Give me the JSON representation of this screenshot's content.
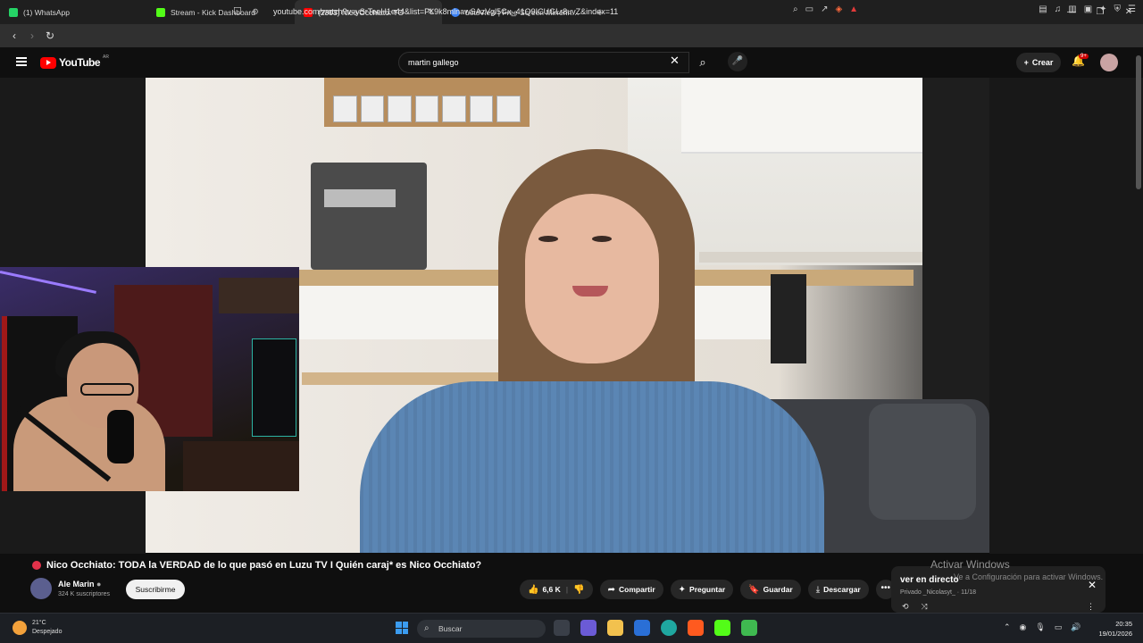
{
  "browser": {
    "tabs": [
      {
        "label": "(1) WhatsApp",
        "color": "#25d366"
      },
      {
        "label": "Stream - Kick Dashboard",
        "color": "#53fc18"
      },
      {
        "label": "(2303) Nico Occhiato: TO",
        "color": "#ff0000"
      },
      {
        "label": "LetsView | Free Screen Mirroring App",
        "color": "#3b82f6"
      }
    ],
    "url": "youtube.com/watch?v=ySrTeeH1e44&list=PL9k8mlnawSAzVgl5Gx_41Q9ICUGLr8uvZ&index=11"
  },
  "youtube": {
    "logo_text": "YouTube",
    "logo_country": "AR",
    "search_value": "martin gallego",
    "create_label": "Crear",
    "notif_badge": "9+"
  },
  "video": {
    "title": "Nico Occhiato: TODA la VERDAD de lo que pasó en Luzu TV I Quién caraj* es Nico Occhiato?",
    "channel": "Ale Marin",
    "subscribers": "324 K suscriptores",
    "subscribe_label": "Suscribirme",
    "likes": "6,6 K",
    "share_label": "Compartir",
    "ask_label": "Preguntar",
    "save_label": "Guardar",
    "download_label": "Descargar"
  },
  "live_panel": {
    "title": "ver en directo",
    "subtitle": "Privado _Nicolasyt_ · 11/18"
  },
  "watermark": {
    "line1": "Activar Windows",
    "line2": "Ve a Configuración para activar Windows."
  },
  "taskbar": {
    "temperature": "21°C",
    "condition": "Despejado",
    "search_placeholder": "Buscar",
    "time": "20:35",
    "date": "19/01/2026"
  }
}
